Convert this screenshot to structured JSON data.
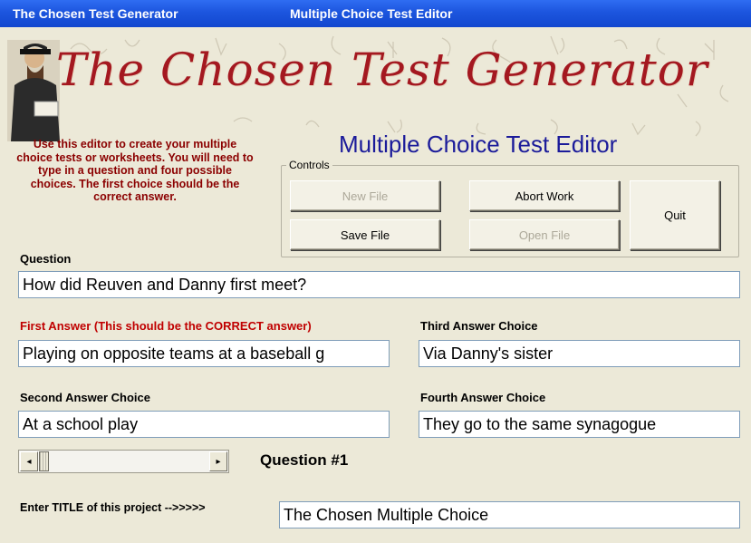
{
  "window": {
    "app_title": "The Chosen Test Generator",
    "form_title": "Multiple Choice Test Editor"
  },
  "banner": {
    "title": "The Chosen Test Generator"
  },
  "instructions": "Use this editor to create your multiple choice tests or worksheets.  You will need to type in a question and four possible choices.  The first choice should be the correct answer.",
  "editor_heading": "Multiple Choice Test Editor",
  "controls": {
    "group_label": "Controls",
    "new_file": "New File",
    "save_file": "Save File",
    "abort_work": "Abort Work",
    "open_file": "Open File",
    "quit": "Quit"
  },
  "question": {
    "label": "Question",
    "value": "How did Reuven and Danny first meet?"
  },
  "answers": {
    "first_label": "First Answer (This should be the CORRECT answer)",
    "first_value": "Playing on opposite teams at a baseball g",
    "second_label": "Second Answer Choice",
    "second_value": "At a school play",
    "third_label": "Third Answer Choice",
    "third_value": "Via Danny's sister",
    "fourth_label": "Fourth Answer Choice",
    "fourth_value": "They go to the same synagogue"
  },
  "navigation": {
    "question_number": "Question #1",
    "left_arrow": "◂",
    "right_arrow": "▸"
  },
  "project": {
    "label": "Enter TITLE of this project -->>>>>",
    "value": "The Chosen Multiple Choice"
  },
  "colors": {
    "titlebar": "#1c55de",
    "banner_title": "#a41820",
    "instructions": "#8b0000",
    "heading": "#1b1b9a",
    "first_answer_label": "#c00000"
  },
  "icons": {
    "banner_image": "reading-man-illustration",
    "scroll_left": "scroll-left-arrow-icon",
    "scroll_right": "scroll-right-arrow-icon"
  }
}
